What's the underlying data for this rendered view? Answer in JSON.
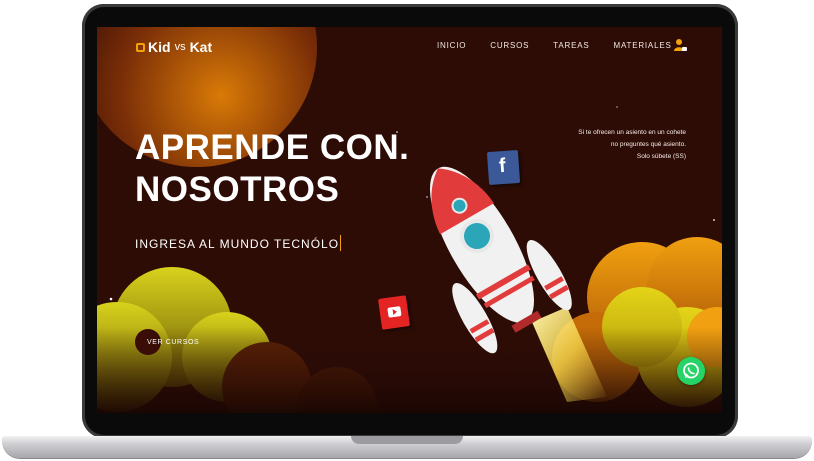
{
  "header": {
    "logo_text": "Kid",
    "logo_vs": "vs",
    "logo_text_2": "Kat",
    "nav_items": [
      {
        "label": "INICIO"
      },
      {
        "label": "CURSOS"
      },
      {
        "label": "TAREAS"
      },
      {
        "label": "MATERIALES"
      }
    ]
  },
  "hero": {
    "title_line1": "APRENDE CON.",
    "title_line2": "NOSOTROS",
    "subtitle": "INGRESA AL MUNDO TECNÓLO",
    "cta_label": "VER CURSOS"
  },
  "quote": {
    "line1": "Si te ofrecen un asiento en un cohete",
    "line2": "no preguntes qué asiento.",
    "line3": "Solo súbete (SS)"
  },
  "social": {
    "facebook_glyph": "f"
  },
  "colors": {
    "background": "#2e0c06",
    "accent": "#f2a20c",
    "cloud_yellow": "#d8d21c",
    "cloud_orange": "#f0a010",
    "facebook": "#3b5998",
    "youtube": "#e42323",
    "whatsapp": "#25d366"
  },
  "icons": [
    "user-icon",
    "facebook-icon",
    "youtube-icon",
    "whatsapp-icon",
    "rocket-illustration"
  ]
}
